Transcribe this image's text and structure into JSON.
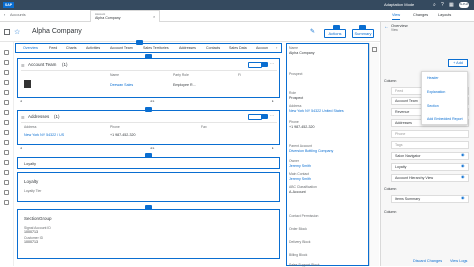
{
  "topbar": {
    "app_logo": "SAP",
    "title": "Adaptation Mode",
    "avatar": "ALPHA"
  },
  "tabbar": {
    "back_label": "Accounts",
    "tab_label": "Alpha Company",
    "tab_sub": "Account"
  },
  "header": {
    "title": "Alpha Company",
    "actions_label": "Actions",
    "summary_label": "Summary"
  },
  "subtabs": [
    "Overview",
    "Feed",
    "Charts",
    "Activities",
    "Account Team",
    "Sales Territories",
    "Addresses",
    "Contacts",
    "Sales Data",
    "Accoun"
  ],
  "account_team": {
    "title": "Account Team",
    "count": "(1)",
    "columns": [
      "",
      "Name",
      "Party Role",
      "Fi"
    ],
    "row": {
      "name": "Deewan Sales",
      "role": "Employee R..."
    }
  },
  "addresses": {
    "title": "Addresses",
    "count": "(1)",
    "columns": [
      "Address",
      "Phone",
      "Fax"
    ],
    "row": {
      "address": "New York NY 54322 / US",
      "phone": "+1 987-452-320"
    }
  },
  "loyalty_1": {
    "title": "Loyalty"
  },
  "loyalty_2": {
    "title": "Loyalty",
    "field": "Loyalty Tier"
  },
  "section_group": {
    "title": "SectionGroup",
    "fields": [
      {
        "label": "Signal Account ID",
        "value": "1000713"
      },
      {
        "label": "Customer ID",
        "value": "1000713"
      }
    ]
  },
  "midpanel": {
    "fields": [
      {
        "label": "Name",
        "value": "Alpha Company",
        "link": false
      },
      {
        "label": "Prospect",
        "value": "",
        "link": false
      },
      {
        "label": "Role",
        "value": "Prospect",
        "link": false
      },
      {
        "label": "Address",
        "value": "New York NY 54322 United States",
        "link": true
      },
      {
        "label": "Phone",
        "value": "+1 987-452-320",
        "link": false
      },
      {
        "label": "Parent Account",
        "value": "Diversion Bottling Company",
        "link": true
      },
      {
        "label": "Owner",
        "value": "Jeremy Smith",
        "link": true
      },
      {
        "label": "Main Contact",
        "value": "Jeremy Smith",
        "link": true
      },
      {
        "label": "ABC Classification",
        "value": "A-Account",
        "link": false
      },
      {
        "label": "Contact Permission",
        "value": "",
        "link": false
      },
      {
        "label": "Order Block",
        "value": "",
        "link": false
      },
      {
        "label": "Delivery Block",
        "value": "",
        "link": false
      },
      {
        "label": "Billing Block",
        "value": "",
        "link": false
      },
      {
        "label": "Sales Support Block",
        "value": "",
        "link": false
      }
    ]
  },
  "right_panel": {
    "tabs": [
      "View",
      "Overview",
      "Changes",
      "Layouts"
    ],
    "back": "Overview",
    "sub": "View",
    "add_label": "Add",
    "column1_label": "Column",
    "column2_label": "Column",
    "column3_label": "Column",
    "rows1": [
      {
        "label": "Feed",
        "dim": true
      },
      {
        "label": "Account Team",
        "dim": false
      },
      {
        "label": "Revenue",
        "dim": false
      },
      {
        "label": "Addresses",
        "dim": false
      }
    ],
    "rows2": [
      {
        "label": "Phone",
        "dim": true
      },
      {
        "label": "Tags",
        "dim": true
      },
      {
        "label": "Salon Navigator",
        "dim": false
      },
      {
        "label": "Loyalty",
        "dim": false
      },
      {
        "label": "Account Hierarchy View",
        "dim": false
      }
    ],
    "rows3": [
      {
        "label": "Items Summary",
        "dim": false
      }
    ],
    "menu": [
      "Header",
      "Explanation",
      "Section",
      "Add Embedded Report"
    ],
    "footer": [
      "Discard Changes",
      "View Logs"
    ]
  },
  "colors": {
    "accent": "#0a6ed1",
    "shell": "#354a5f"
  }
}
